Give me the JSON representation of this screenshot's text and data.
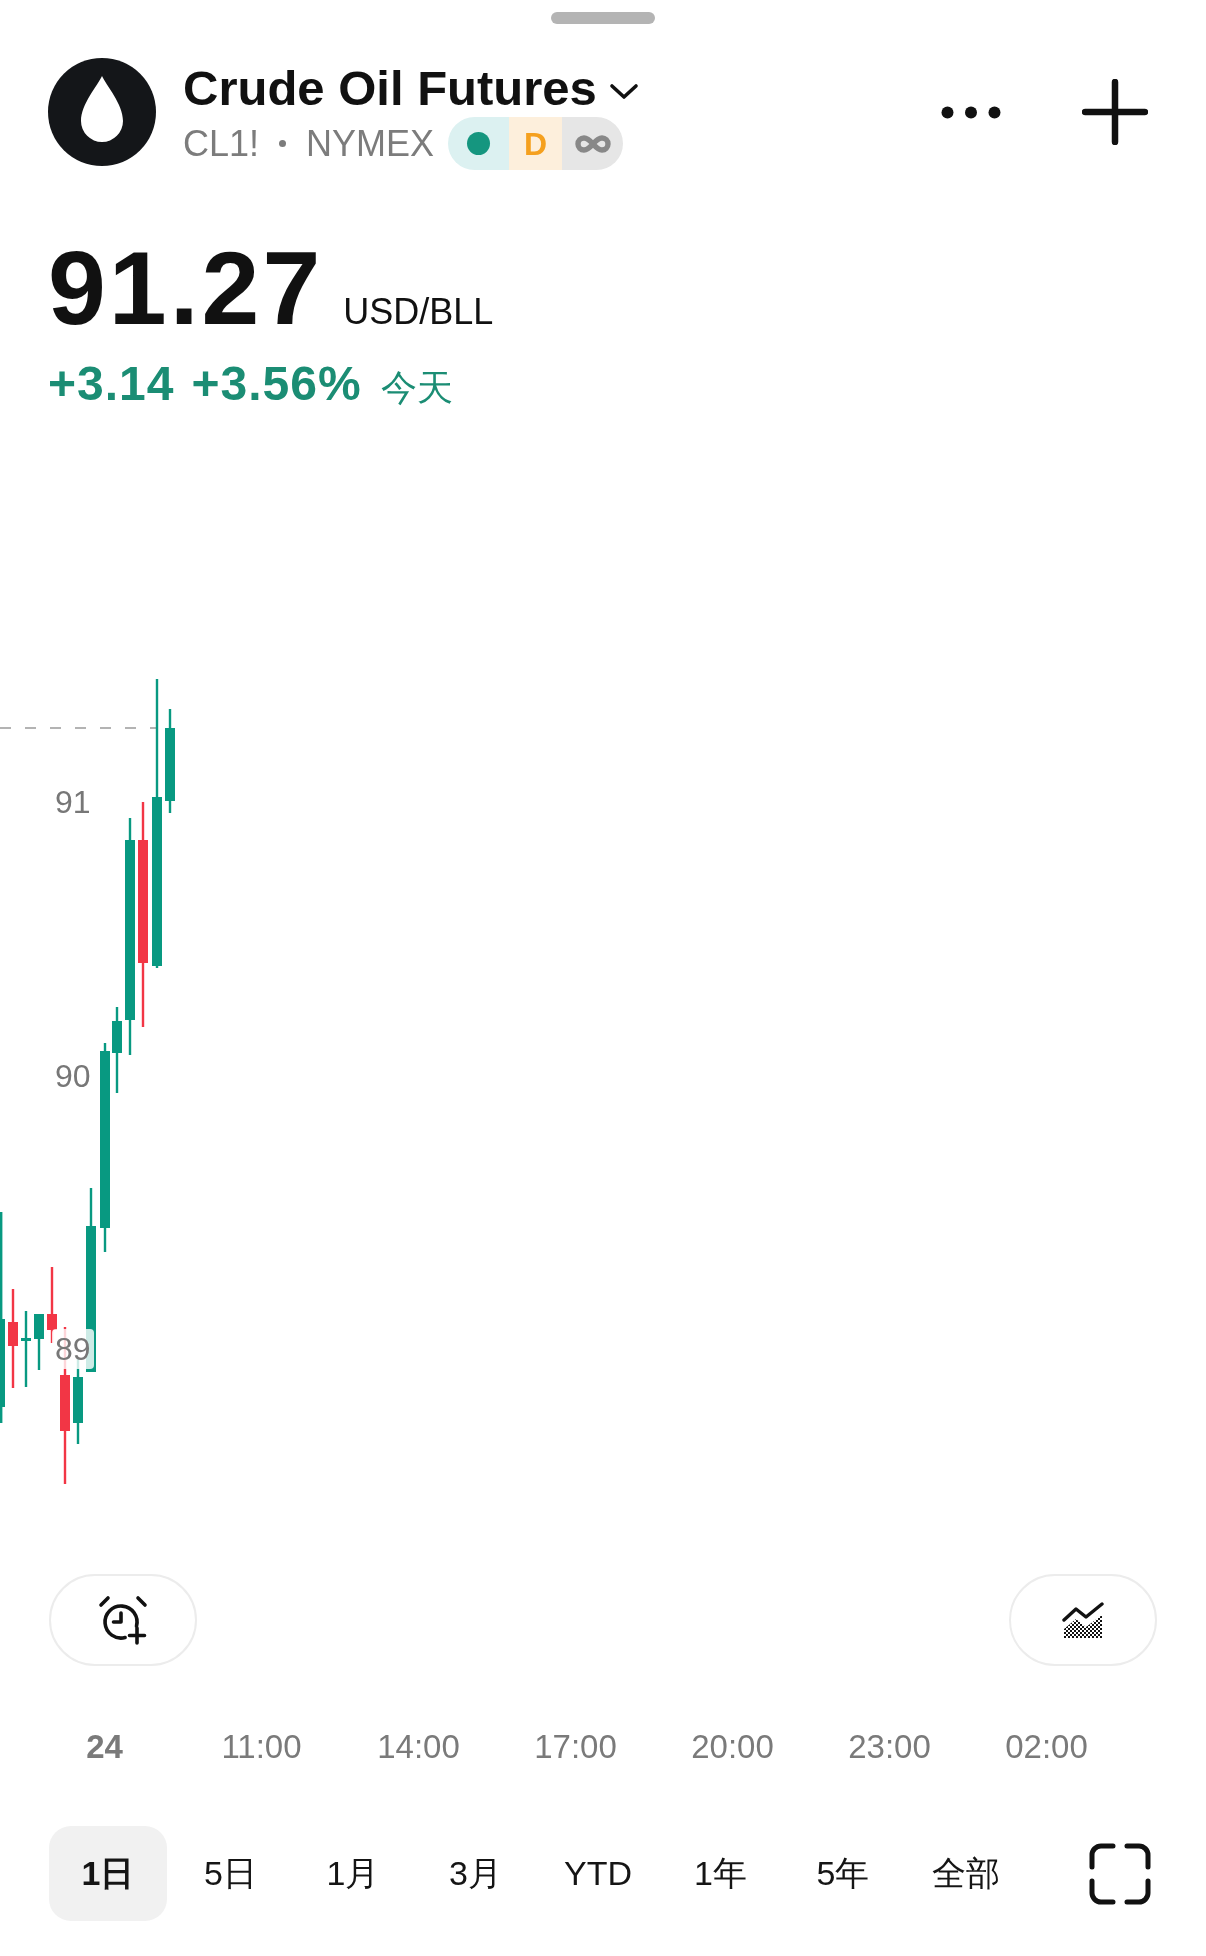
{
  "header": {
    "title": "Crude Oil Futures",
    "symbol": "CL1!",
    "exchange": "NYMEX",
    "badges": [
      {
        "kind": "dot",
        "color": "#15967f"
      },
      {
        "kind": "letter",
        "label": "D"
      },
      {
        "kind": "infinity"
      }
    ]
  },
  "quote": {
    "price": "91.27",
    "unit": "USD/BLL",
    "rising": true,
    "change": "+3.14",
    "change_percent": "+3.56%",
    "period": "今天"
  },
  "chart": {
    "y_labels": [
      "91",
      "90",
      "89"
    ],
    "x_labels": [
      {
        "kind": "date",
        "label": "24"
      },
      {
        "kind": "time",
        "label": "11:00"
      },
      {
        "kind": "time",
        "label": "14:00"
      },
      {
        "kind": "time",
        "label": "17:00"
      },
      {
        "kind": "time",
        "label": "20:00"
      },
      {
        "kind": "time",
        "label": "23:00"
      },
      {
        "kind": "time",
        "label": "02:00"
      }
    ]
  },
  "ranges": [
    {
      "label": "1日",
      "selected": true
    },
    {
      "label": "5日",
      "selected": false
    },
    {
      "label": "1月",
      "selected": false
    },
    {
      "label": "3月",
      "selected": false
    },
    {
      "label": "YTD",
      "selected": false
    },
    {
      "label": "1年",
      "selected": false
    },
    {
      "label": "5年",
      "selected": false
    },
    {
      "label": "全部",
      "selected": false
    }
  ]
}
